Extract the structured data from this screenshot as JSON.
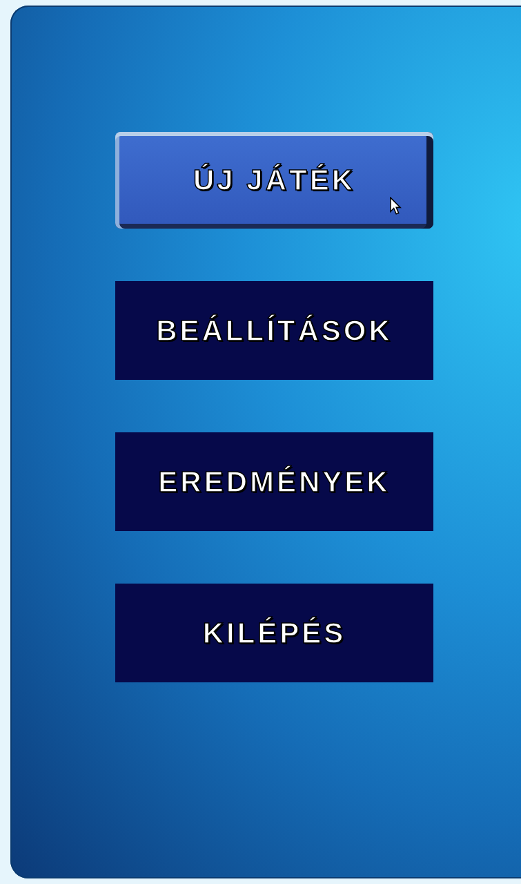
{
  "menu": {
    "buttons": [
      {
        "label": "ÚJ JÁTÉK",
        "hovered": true
      },
      {
        "label": "BEÁLLÍTÁSOK",
        "hovered": false
      },
      {
        "label": "EREDMÉNYEK",
        "hovered": false
      },
      {
        "label": "KILÉPÉS",
        "hovered": false
      }
    ]
  }
}
